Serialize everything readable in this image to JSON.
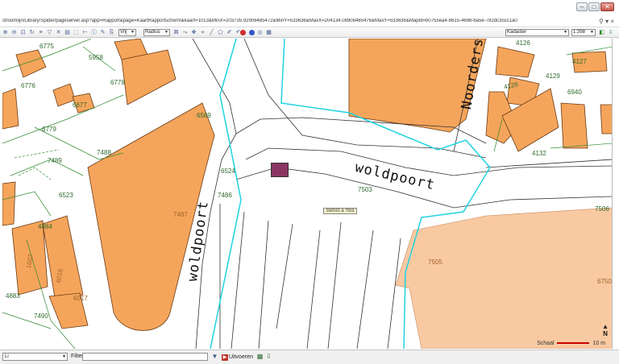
{
  "window": {
    "minimize_label": "–",
    "maximize_label": "□",
    "close_label": "✕"
  },
  "address": {
    "url": "stroomlijn/Library/Spider/pageserver.asp?app=Rapport&page=KaartRapportscherm&kaart=1013&MinX=203735.92908485472&MinY=533636&MaxX=204134.08908485476&MaxY=533636&MapId=b0755ea4-8615-469b-8a5e-782dc35cc1a0",
    "search_icon": "search-icon",
    "go_label": "▾"
  },
  "toolbar": {
    "vrij_select": "Vrij",
    "radius_select": "Radius",
    "layer_select": "Kadaster",
    "scale_select": "1:398",
    "colors": {
      "red_dot": "#cc2b2b",
      "blue_dot": "#3355cc"
    }
  },
  "map": {
    "street_names": {
      "woldpoort_h": "woldpoort",
      "woldpoort_v": "woldpoort",
      "noorders": "Noorders"
    },
    "parcel_labels": [
      {
        "id": "6775",
        "text": "6775"
      },
      {
        "id": "5958",
        "text": "5958"
      },
      {
        "id": "6776",
        "text": "6776"
      },
      {
        "id": "6778",
        "text": "6778"
      },
      {
        "id": "6677",
        "text": "6677"
      },
      {
        "id": "6779",
        "text": "6779"
      },
      {
        "id": "6589",
        "text": "6589"
      },
      {
        "id": "7488",
        "text": "7488"
      },
      {
        "id": "7489",
        "text": "7489"
      },
      {
        "id": "6523",
        "text": "6523"
      },
      {
        "id": "6524",
        "text": "6524"
      },
      {
        "id": "7486",
        "text": "7486"
      },
      {
        "id": "7487",
        "text": "7487"
      },
      {
        "id": "4884",
        "text": "4884"
      },
      {
        "id": "1607",
        "text": "1607"
      },
      {
        "id": "6016",
        "text": "6016"
      },
      {
        "id": "4883",
        "text": "4883"
      },
      {
        "id": "6017",
        "text": "6017"
      },
      {
        "id": "7490",
        "text": "7490"
      },
      {
        "id": "7503",
        "text": "7503"
      },
      {
        "id": "7505",
        "text": "7505"
      },
      {
        "id": "7506",
        "text": "7506"
      },
      {
        "id": "6750",
        "text": "6750"
      },
      {
        "id": "4126",
        "text": "4126"
      },
      {
        "id": "4127",
        "text": "4127"
      },
      {
        "id": "4128",
        "text": "4128"
      },
      {
        "id": "4129",
        "text": "4129"
      },
      {
        "id": "6940",
        "text": "6940"
      },
      {
        "id": "4132",
        "text": "4132"
      }
    ],
    "sign_text": "SWO01 & 7503",
    "scale_label": "Schaal",
    "scale_value": "10 m",
    "north_label": "N",
    "colors": {
      "building": "#f5a55b",
      "building_light": "#f9c9a2",
      "parcel_line": "#2f8a2f",
      "boundary": "#1fd3e0",
      "marker": "#8c3663"
    }
  },
  "bottombar": {
    "layer_value": "Li",
    "filter_label": "Filter",
    "filter_value": "",
    "run_label": "Uitvoeren"
  }
}
